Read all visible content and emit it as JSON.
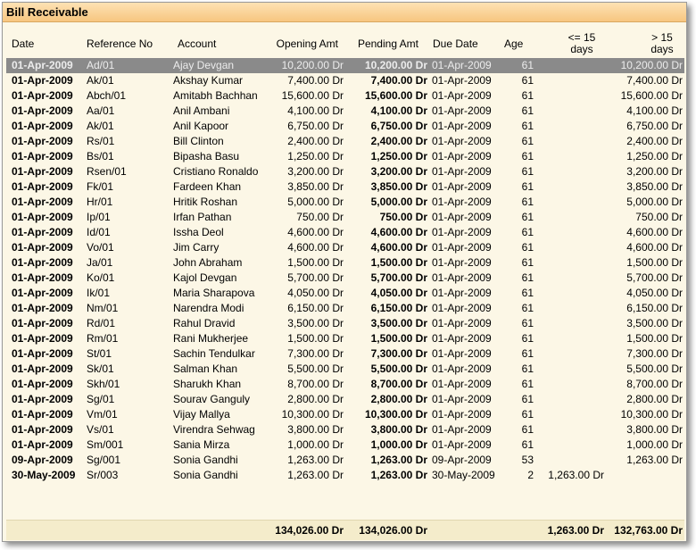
{
  "window": {
    "title": "Bill Receivable"
  },
  "columns": {
    "date": "Date",
    "reference": "Reference No",
    "account": "Account",
    "opening": "Opening Amt",
    "pending": "Pending Amt",
    "due_date": "Due Date",
    "age": "Age",
    "le15_line1": "<= 15",
    "le15_line2": "days",
    "gt15_line1": "> 15",
    "gt15_line2": "days"
  },
  "rows": [
    {
      "date": "01-Apr-2009",
      "ref": "Ad/01",
      "account": "Ajay Devgan",
      "opening": "10,200.00 Dr",
      "pending": "10,200.00 Dr",
      "due": "01-Apr-2009",
      "age": "61",
      "le15": "",
      "gt15": "10,200.00 Dr"
    },
    {
      "date": "01-Apr-2009",
      "ref": "Ak/01",
      "account": "Akshay Kumar",
      "opening": "7,400.00 Dr",
      "pending": "7,400.00 Dr",
      "due": "01-Apr-2009",
      "age": "61",
      "le15": "",
      "gt15": "7,400.00 Dr"
    },
    {
      "date": "01-Apr-2009",
      "ref": "Abch/01",
      "account": "Amitabh Bachhan",
      "opening": "15,600.00 Dr",
      "pending": "15,600.00 Dr",
      "due": "01-Apr-2009",
      "age": "61",
      "le15": "",
      "gt15": "15,600.00 Dr"
    },
    {
      "date": "01-Apr-2009",
      "ref": "Aa/01",
      "account": "Anil Ambani",
      "opening": "4,100.00 Dr",
      "pending": "4,100.00 Dr",
      "due": "01-Apr-2009",
      "age": "61",
      "le15": "",
      "gt15": "4,100.00 Dr"
    },
    {
      "date": "01-Apr-2009",
      "ref": "Ak/01",
      "account": "Anil Kapoor",
      "opening": "6,750.00 Dr",
      "pending": "6,750.00 Dr",
      "due": "01-Apr-2009",
      "age": "61",
      "le15": "",
      "gt15": "6,750.00 Dr"
    },
    {
      "date": "01-Apr-2009",
      "ref": "Rs/01",
      "account": "Bill Clinton",
      "opening": "2,400.00 Dr",
      "pending": "2,400.00 Dr",
      "due": "01-Apr-2009",
      "age": "61",
      "le15": "",
      "gt15": "2,400.00 Dr"
    },
    {
      "date": "01-Apr-2009",
      "ref": "Bs/01",
      "account": "Bipasha Basu",
      "opening": "1,250.00 Dr",
      "pending": "1,250.00 Dr",
      "due": "01-Apr-2009",
      "age": "61",
      "le15": "",
      "gt15": "1,250.00 Dr"
    },
    {
      "date": "01-Apr-2009",
      "ref": "Rsen/01",
      "account": "Cristiano Ronaldo",
      "opening": "3,200.00 Dr",
      "pending": "3,200.00 Dr",
      "due": "01-Apr-2009",
      "age": "61",
      "le15": "",
      "gt15": "3,200.00 Dr"
    },
    {
      "date": "01-Apr-2009",
      "ref": "Fk/01",
      "account": "Fardeen Khan",
      "opening": "3,850.00 Dr",
      "pending": "3,850.00 Dr",
      "due": "01-Apr-2009",
      "age": "61",
      "le15": "",
      "gt15": "3,850.00 Dr"
    },
    {
      "date": "01-Apr-2009",
      "ref": "Hr/01",
      "account": "Hritik Roshan",
      "opening": "5,000.00 Dr",
      "pending": "5,000.00 Dr",
      "due": "01-Apr-2009",
      "age": "61",
      "le15": "",
      "gt15": "5,000.00 Dr"
    },
    {
      "date": "01-Apr-2009",
      "ref": "Ip/01",
      "account": "Irfan Pathan",
      "opening": "750.00 Dr",
      "pending": "750.00 Dr",
      "due": "01-Apr-2009",
      "age": "61",
      "le15": "",
      "gt15": "750.00 Dr"
    },
    {
      "date": "01-Apr-2009",
      "ref": "Id/01",
      "account": "Issha Deol",
      "opening": "4,600.00 Dr",
      "pending": "4,600.00 Dr",
      "due": "01-Apr-2009",
      "age": "61",
      "le15": "",
      "gt15": "4,600.00 Dr"
    },
    {
      "date": "01-Apr-2009",
      "ref": "Vo/01",
      "account": "Jim Carry",
      "opening": "4,600.00 Dr",
      "pending": "4,600.00 Dr",
      "due": "01-Apr-2009",
      "age": "61",
      "le15": "",
      "gt15": "4,600.00 Dr"
    },
    {
      "date": "01-Apr-2009",
      "ref": "Ja/01",
      "account": "John Abraham",
      "opening": "1,500.00 Dr",
      "pending": "1,500.00 Dr",
      "due": "01-Apr-2009",
      "age": "61",
      "le15": "",
      "gt15": "1,500.00 Dr"
    },
    {
      "date": "01-Apr-2009",
      "ref": "Ko/01",
      "account": "Kajol Devgan",
      "opening": "5,700.00 Dr",
      "pending": "5,700.00 Dr",
      "due": "01-Apr-2009",
      "age": "61",
      "le15": "",
      "gt15": "5,700.00 Dr"
    },
    {
      "date": "01-Apr-2009",
      "ref": "Ik/01",
      "account": "Maria Sharapova",
      "opening": "4,050.00 Dr",
      "pending": "4,050.00 Dr",
      "due": "01-Apr-2009",
      "age": "61",
      "le15": "",
      "gt15": "4,050.00 Dr"
    },
    {
      "date": "01-Apr-2009",
      "ref": "Nm/01",
      "account": "Narendra Modi",
      "opening": "6,150.00 Dr",
      "pending": "6,150.00 Dr",
      "due": "01-Apr-2009",
      "age": "61",
      "le15": "",
      "gt15": "6,150.00 Dr"
    },
    {
      "date": "01-Apr-2009",
      "ref": "Rd/01",
      "account": "Rahul Dravid",
      "opening": "3,500.00 Dr",
      "pending": "3,500.00 Dr",
      "due": "01-Apr-2009",
      "age": "61",
      "le15": "",
      "gt15": "3,500.00 Dr"
    },
    {
      "date": "01-Apr-2009",
      "ref": "Rm/01",
      "account": "Rani Mukherjee",
      "opening": "1,500.00 Dr",
      "pending": "1,500.00 Dr",
      "due": "01-Apr-2009",
      "age": "61",
      "le15": "",
      "gt15": "1,500.00 Dr"
    },
    {
      "date": "01-Apr-2009",
      "ref": "St/01",
      "account": "Sachin Tendulkar",
      "opening": "7,300.00 Dr",
      "pending": "7,300.00 Dr",
      "due": "01-Apr-2009",
      "age": "61",
      "le15": "",
      "gt15": "7,300.00 Dr"
    },
    {
      "date": "01-Apr-2009",
      "ref": "Sk/01",
      "account": "Salman Khan",
      "opening": "5,500.00 Dr",
      "pending": "5,500.00 Dr",
      "due": "01-Apr-2009",
      "age": "61",
      "le15": "",
      "gt15": "5,500.00 Dr"
    },
    {
      "date": "01-Apr-2009",
      "ref": "Skh/01",
      "account": "Sharukh Khan",
      "opening": "8,700.00 Dr",
      "pending": "8,700.00 Dr",
      "due": "01-Apr-2009",
      "age": "61",
      "le15": "",
      "gt15": "8,700.00 Dr"
    },
    {
      "date": "01-Apr-2009",
      "ref": "Sg/01",
      "account": "Sourav Ganguly",
      "opening": "2,800.00 Dr",
      "pending": "2,800.00 Dr",
      "due": "01-Apr-2009",
      "age": "61",
      "le15": "",
      "gt15": "2,800.00 Dr"
    },
    {
      "date": "01-Apr-2009",
      "ref": "Vm/01",
      "account": "Vijay Mallya",
      "opening": "10,300.00 Dr",
      "pending": "10,300.00 Dr",
      "due": "01-Apr-2009",
      "age": "61",
      "le15": "",
      "gt15": "10,300.00 Dr"
    },
    {
      "date": "01-Apr-2009",
      "ref": "Vs/01",
      "account": "Virendra Sehwag",
      "opening": "3,800.00 Dr",
      "pending": "3,800.00 Dr",
      "due": "01-Apr-2009",
      "age": "61",
      "le15": "",
      "gt15": "3,800.00 Dr"
    },
    {
      "date": "01-Apr-2009",
      "ref": "Sm/001",
      "account": "Sania Mirza",
      "opening": "1,000.00 Dr",
      "pending": "1,000.00 Dr",
      "due": "01-Apr-2009",
      "age": "61",
      "le15": "",
      "gt15": "1,000.00 Dr"
    },
    {
      "date": "09-Apr-2009",
      "ref": "Sg/001",
      "account": "Sonia Gandhi",
      "opening": "1,263.00 Dr",
      "pending": "1,263.00 Dr",
      "due": "09-Apr-2009",
      "age": "53",
      "le15": "",
      "gt15": "1,263.00 Dr"
    },
    {
      "date": "30-May-2009",
      "ref": "Sr/003",
      "account": "Sonia Gandhi",
      "opening": "1,263.00 Dr",
      "pending": "1,263.00 Dr",
      "due": "30-May-2009",
      "age": "2",
      "le15": "1,263.00 Dr",
      "gt15": ""
    }
  ],
  "selected_row": 0,
  "totals": {
    "opening": "134,026.00 Dr",
    "pending": "134,026.00 Dr",
    "le15": "1,263.00 Dr",
    "gt15": "132,763.00 Dr"
  }
}
